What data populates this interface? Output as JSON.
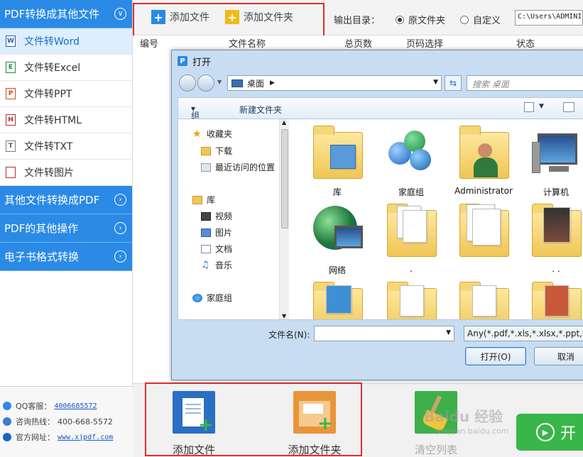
{
  "sidebar": {
    "category1": "PDF转换成其他文件",
    "items": [
      {
        "label": "文件转Word",
        "badge": "W"
      },
      {
        "label": "文件转Excel",
        "badge": "E"
      },
      {
        "label": "文件转PPT",
        "badge": "P"
      },
      {
        "label": "文件转HTML",
        "badge": "H"
      },
      {
        "label": "文件转TXT",
        "badge": "T"
      },
      {
        "label": "文件转图片",
        "badge": ""
      }
    ],
    "category2": "其他文件转换成PDF",
    "category3": "PDF的其他操作",
    "category4": "电子书格式转换",
    "contact": {
      "qq_label": "QQ客服：",
      "qq_value": "4006685572",
      "hotline_label": "咨询热线：",
      "hotline_value": "400-668-5572",
      "site_label": "官方网址：",
      "site_value": "www.xjpdf.com"
    }
  },
  "toolbar": {
    "add_file": "添加文件",
    "add_folder": "添加文件夹",
    "output_label": "输出目录：",
    "radio_original": "原文件夹",
    "radio_custom": "自定义",
    "path_value": "C:\\Users\\ADMINI"
  },
  "table": {
    "col_number": "编号",
    "col_name": "文件名称",
    "col_pages": "总页数",
    "col_page_select": "页码选择",
    "col_status": "状态"
  },
  "dialog": {
    "title": "打开",
    "address": "桌面",
    "search_placeholder": "搜索 桌面",
    "organize": "组织",
    "new_folder": "新建文件夹",
    "nav": {
      "favorites": "收藏夹",
      "downloads": "下载",
      "recent": "最近访问的位置",
      "libraries": "库",
      "videos": "视频",
      "pictures": "图片",
      "documents": "文档",
      "music": "音乐",
      "homegroup": "家庭组"
    },
    "files": [
      {
        "label": "库"
      },
      {
        "label": "家庭组"
      },
      {
        "label": "Administrator"
      },
      {
        "label": "计算机"
      },
      {
        "label": "网络"
      },
      {
        "label": "."
      },
      {
        "label": ""
      },
      {
        "label": ". ."
      }
    ],
    "filename_label": "文件名(N):",
    "filename_value": "",
    "filetype_value": "Any(*.pdf,*.xls,*.xlsx,*.ppt,*.pp",
    "open_button": "打开(O)",
    "cancel_button": "取消"
  },
  "bottom": {
    "add_file": "添加文件",
    "add_folder": "添加文件夹",
    "clear_list": "清空列表",
    "start_label": "开",
    "watermark": "Baidu 经验",
    "watermark_sub": "jingyan.baidu.com"
  },
  "colors": {
    "accent_blue": "#2a8ae6",
    "highlight_red": "#e12d2d",
    "start_green": "#39b64a"
  }
}
